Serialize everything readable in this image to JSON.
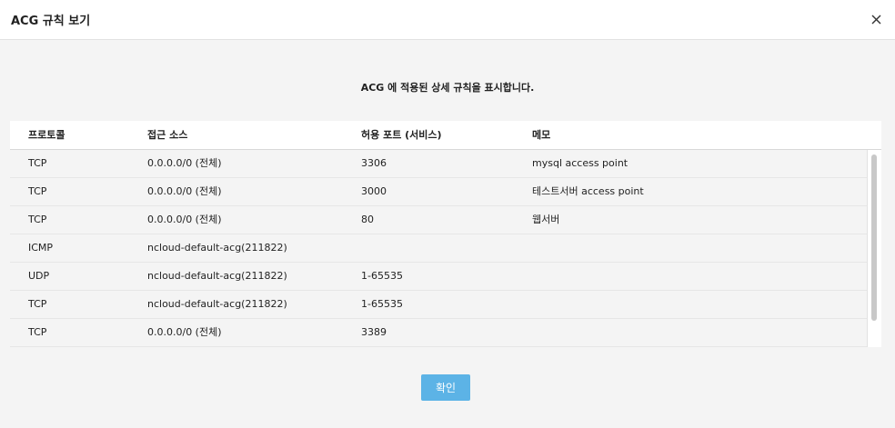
{
  "dialog": {
    "title": "ACG 규칙 보기",
    "close_icon": "close-icon",
    "description": "ACG 에 적용된 상세 규칙을 표시합니다.",
    "confirm_label": "확인"
  },
  "table": {
    "headers": [
      "프로토콜",
      "접근 소스",
      "허용 포트 (서비스)",
      "메모"
    ],
    "rows": [
      [
        "TCP",
        "0.0.0.0/0 (전체)",
        "3306",
        "mysql access point"
      ],
      [
        "TCP",
        "0.0.0.0/0 (전체)",
        "3000",
        "테스트서버 access point"
      ],
      [
        "TCP",
        "0.0.0.0/0 (전체)",
        "80",
        "웹서버"
      ],
      [
        "ICMP",
        "ncloud-default-acg(211822)",
        "",
        ""
      ],
      [
        "UDP",
        "ncloud-default-acg(211822)",
        "1-65535",
        ""
      ],
      [
        "TCP",
        "ncloud-default-acg(211822)",
        "1-65535",
        ""
      ],
      [
        "TCP",
        "0.0.0.0/0 (전체)",
        "3389",
        ""
      ]
    ]
  },
  "colors": {
    "accent": "#5cb3e6",
    "background": "#f4f4f4"
  }
}
